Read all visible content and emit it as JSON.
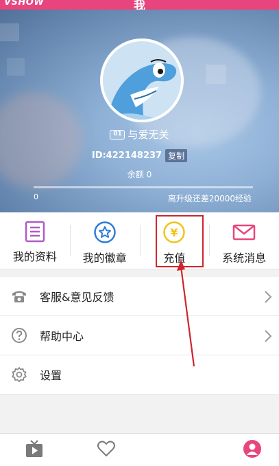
{
  "header": {
    "logo_text": "VSHOW",
    "title": "我"
  },
  "profile": {
    "level_badge": "01",
    "nickname": "与爱无关",
    "id_text": "ID:422148237",
    "copy_label": "复制",
    "balance_text": "余额  0",
    "progress_left": "0",
    "progress_right": "离升级还差20000经验",
    "progress_fraction": 0
  },
  "functions": [
    {
      "label": "我的资料",
      "icon": "profile-doc-icon",
      "color": "#b05cc5"
    },
    {
      "label": "我的徽章",
      "icon": "badge-star-icon",
      "color": "#2e7dd4"
    },
    {
      "label": "充值",
      "icon": "yen-coin-icon",
      "color": "#f0c419"
    },
    {
      "label": "系统消息",
      "icon": "mail-icon",
      "color": "#e8457f"
    }
  ],
  "menu": [
    {
      "label": "客服&意见反馈",
      "icon": "phone-icon",
      "has_chevron": true
    },
    {
      "label": "帮助中心",
      "icon": "help-icon",
      "has_chevron": true
    },
    {
      "label": "设置",
      "icon": "settings-gear-icon",
      "has_chevron": false
    }
  ],
  "bottom_nav": [
    {
      "icon": "tv-play-icon"
    },
    {
      "icon": "heart-icon"
    },
    {
      "icon": "user-icon",
      "active": true
    }
  ],
  "colors": {
    "brand_pink": "#e8457f",
    "highlight_red": "#d0242b"
  }
}
